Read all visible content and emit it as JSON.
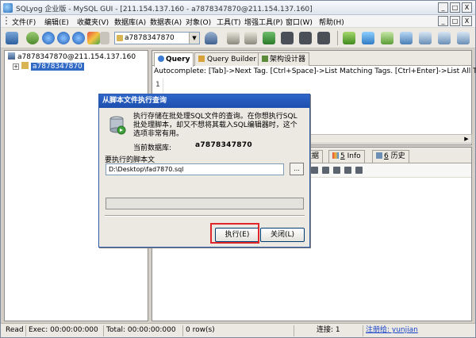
{
  "window": {
    "title": "SQLyog 企业版 - MySQL GUI - [211.154.137.160 - a7878347870@211.154.137.160]",
    "controls": {
      "minimize": "_",
      "maximize": "□",
      "close": "X"
    }
  },
  "menubar": {
    "items": [
      "文件(F)",
      "编辑(E)",
      "收藏夹(V)",
      "数据库(A)",
      "数据表(A)",
      "对象(O)",
      "工具(T)",
      "增强工具(P)",
      "窗口(W)",
      "帮助(H)"
    ],
    "mdi_controls": [
      "_",
      "□",
      "X"
    ]
  },
  "toolbar": {
    "database_select": "a7878347870",
    "dropdown_arrow": "▼",
    "icons": [
      "connect-icon",
      "disconnect-icon",
      "execute-icon",
      "execute-all-icon",
      "stop-icon",
      "refresh-icon",
      "favorites-icon",
      "user-icon",
      "table-icon",
      "schema-icon",
      "import-icon",
      "export-icon",
      "backup-icon",
      "restore-icon",
      "sync-icon",
      "query-builder-icon",
      "designer-icon",
      "preferences-icon"
    ]
  },
  "object_browser": {
    "connection": "a7878347870@211.154.137.160",
    "expand_marker": "+",
    "database": "a7878347870"
  },
  "query_editor": {
    "tabs": [
      {
        "label": "Query",
        "active": true
      },
      {
        "label": "Query Builder",
        "active": false
      },
      {
        "label": "架构设计器",
        "active": false
      }
    ],
    "autocomplete_hint": "Autocomplete: [Tab]->Next Tag. [Ctrl+Space]->List Matching Tags. [Ctrl+Enter]->List All Ta",
    "line_number": "1",
    "scroll_arrow": "▶"
  },
  "results": {
    "tabs": [
      {
        "prefix": "",
        "label": "表数据"
      },
      {
        "prefix": "5",
        "label": " Info"
      },
      {
        "prefix": "6",
        "label": " 历史"
      }
    ]
  },
  "dialog": {
    "title": "从脚本文件执行查询",
    "description": "执行存储在批处理SQL文件的查询。在你想执行SQL批处理脚本，却又不想将其载入SQL编辑器时，这个选项非常有用。",
    "current_db_label": "当前数据库:",
    "current_db_value": "a7878347870",
    "script_label": "要执行的脚本文",
    "file_path": "D:\\Desktop\\fad7870.sql",
    "browse_label": "...",
    "progress": 0,
    "execute_label": "执行(E)",
    "close_label": "关闭(L)"
  },
  "statusbar": {
    "mode": "Read",
    "exec": "Exec: 00:00:00:000",
    "total": "Total: 00:00:00:000",
    "rows": "0 row(s)",
    "connection": "连接: 1",
    "registration": "注册给: yunjian"
  }
}
